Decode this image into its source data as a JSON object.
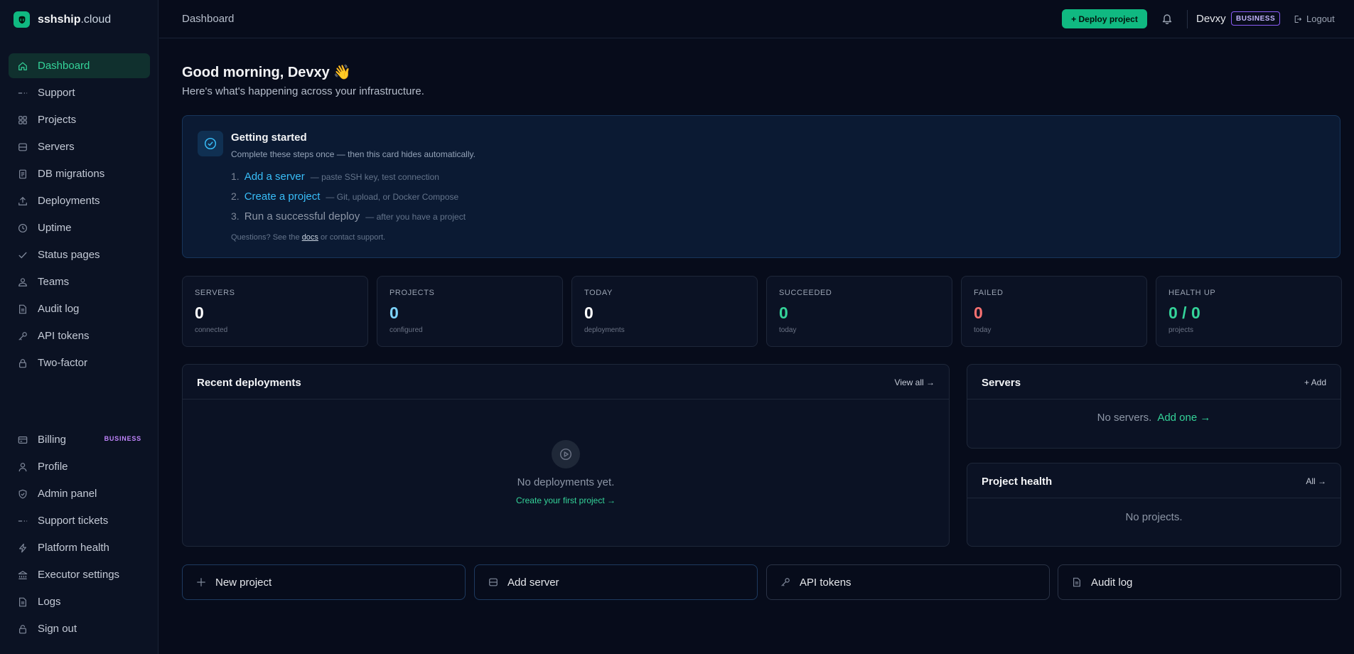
{
  "brand": {
    "name": "sshship",
    "tld": ".cloud"
  },
  "sidebar": {
    "items": [
      {
        "label": "Dashboard",
        "icon": "home-icon"
      },
      {
        "label": "Support",
        "icon": "dash-icon"
      },
      {
        "label": "Projects",
        "icon": "grid-icon"
      },
      {
        "label": "Servers",
        "icon": "server-icon"
      },
      {
        "label": "DB migrations",
        "icon": "document-icon"
      },
      {
        "label": "Deployments",
        "icon": "upload-icon"
      },
      {
        "label": "Uptime",
        "icon": "clock-icon"
      },
      {
        "label": "Status pages",
        "icon": "check-icon"
      },
      {
        "label": "Teams",
        "icon": "users-icon"
      },
      {
        "label": "Audit log",
        "icon": "file-icon"
      },
      {
        "label": "API tokens",
        "icon": "key-icon"
      },
      {
        "label": "Two-factor",
        "icon": "lock-icon"
      }
    ],
    "bottom_items": [
      {
        "label": "Billing",
        "icon": "card-icon",
        "badge": "BUSINESS"
      },
      {
        "label": "Profile",
        "icon": "user-icon"
      },
      {
        "label": "Admin panel",
        "icon": "shield-icon"
      },
      {
        "label": "Support tickets",
        "icon": "dash-icon"
      },
      {
        "label": "Platform health",
        "icon": "bolt-icon"
      },
      {
        "label": "Executor settings",
        "icon": "bank-icon"
      },
      {
        "label": "Logs",
        "icon": "file-icon"
      },
      {
        "label": "Sign out",
        "icon": "signout-icon"
      }
    ]
  },
  "topbar": {
    "breadcrumb": "Dashboard",
    "deploy_label": "+ Deploy project",
    "user_name": "Devxy",
    "plan_badge": "BUSINESS",
    "logout_label": "Logout"
  },
  "greeting": {
    "title": "Good morning, Devxy 👋",
    "subtitle": "Here's what's happening across your infrastructure."
  },
  "getting_started": {
    "title": "Getting started",
    "description": "Complete these steps once — then this card hides automatically.",
    "steps": [
      {
        "num": "1.",
        "label": "Add a server",
        "hint": "— paste SSH key, test connection"
      },
      {
        "num": "2.",
        "label": "Create a project",
        "hint": "— Git, upload, or Docker Compose"
      },
      {
        "num": "3.",
        "label": "Run a successful deploy",
        "hint": "— after you have a project"
      }
    ],
    "footer_pre": "Questions? See the",
    "footer_link": "docs",
    "footer_post": "or contact support."
  },
  "stats": [
    {
      "label": "SERVERS",
      "value": "0",
      "sub": "connected",
      "color": "#ffffff"
    },
    {
      "label": "PROJECTS",
      "value": "0",
      "sub": "configured",
      "color": "#7dd3fc"
    },
    {
      "label": "TODAY",
      "value": "0",
      "sub": "deployments",
      "color": "#ffffff"
    },
    {
      "label": "SUCCEEDED",
      "value": "0",
      "sub": "today",
      "color": "#34d399"
    },
    {
      "label": "FAILED",
      "value": "0",
      "sub": "today",
      "color": "#f87171"
    },
    {
      "label": "HEALTH UP",
      "value": "0 / 0",
      "sub": "projects",
      "color": "#34d399"
    }
  ],
  "recent_deployments": {
    "title": "Recent deployments",
    "action": "View all →",
    "empty_text": "No deployments yet.",
    "empty_link": "Create your first project →"
  },
  "servers_panel": {
    "title": "Servers",
    "action": "+ Add",
    "empty_text": "No servers.",
    "empty_link": "Add one →"
  },
  "project_health": {
    "title": "Project health",
    "action": "All →",
    "empty_text": "No projects."
  },
  "quick_actions": [
    {
      "label": "New project",
      "icon": "plus-icon"
    },
    {
      "label": "Add server",
      "icon": "server-icon"
    },
    {
      "label": "API tokens",
      "icon": "key-icon"
    },
    {
      "label": "Audit log",
      "icon": "file-icon"
    }
  ],
  "colors": {
    "accent": "#10b981",
    "link": "#38bdf8",
    "danger": "#f87171",
    "plan": "#8b5cf6"
  }
}
